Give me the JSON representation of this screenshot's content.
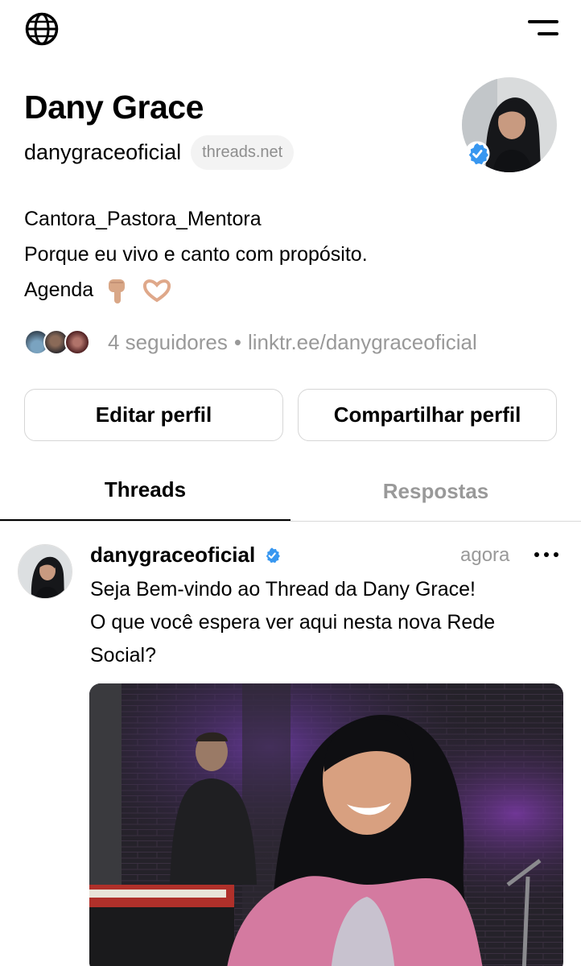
{
  "topbar": {
    "globe_icon": "globe-icon",
    "menu_icon": "menu-icon"
  },
  "profile": {
    "name": "Dany Grace",
    "handle": "danygraceoficial",
    "domain_badge": "threads.net",
    "verified": true,
    "bio_lines": [
      "Cantora_Pastora_Mentora",
      "Porque eu vivo e canto com propósito.",
      "Agenda"
    ],
    "bio_emojis": [
      "pointing-down-icon",
      "heart-hands-icon"
    ],
    "followers": "4 seguidores",
    "separator": "•",
    "link": "linktr.ee/danygraceoficial"
  },
  "actions": {
    "edit": "Editar perfil",
    "share": "Compartilhar perfil"
  },
  "tabs": [
    {
      "label": "Threads",
      "active": true
    },
    {
      "label": "Respostas",
      "active": false
    }
  ],
  "post": {
    "user": "danygraceoficial",
    "time": "agora",
    "text": "Seja Bem-vindo ao Thread da Dany Grace!\nO que você espera ver aqui nesta nova Rede Social?"
  },
  "colors": {
    "verified": "#3897f0",
    "muted": "#999999",
    "border": "#d6d6d6",
    "pill_bg": "#f3f3f3"
  }
}
